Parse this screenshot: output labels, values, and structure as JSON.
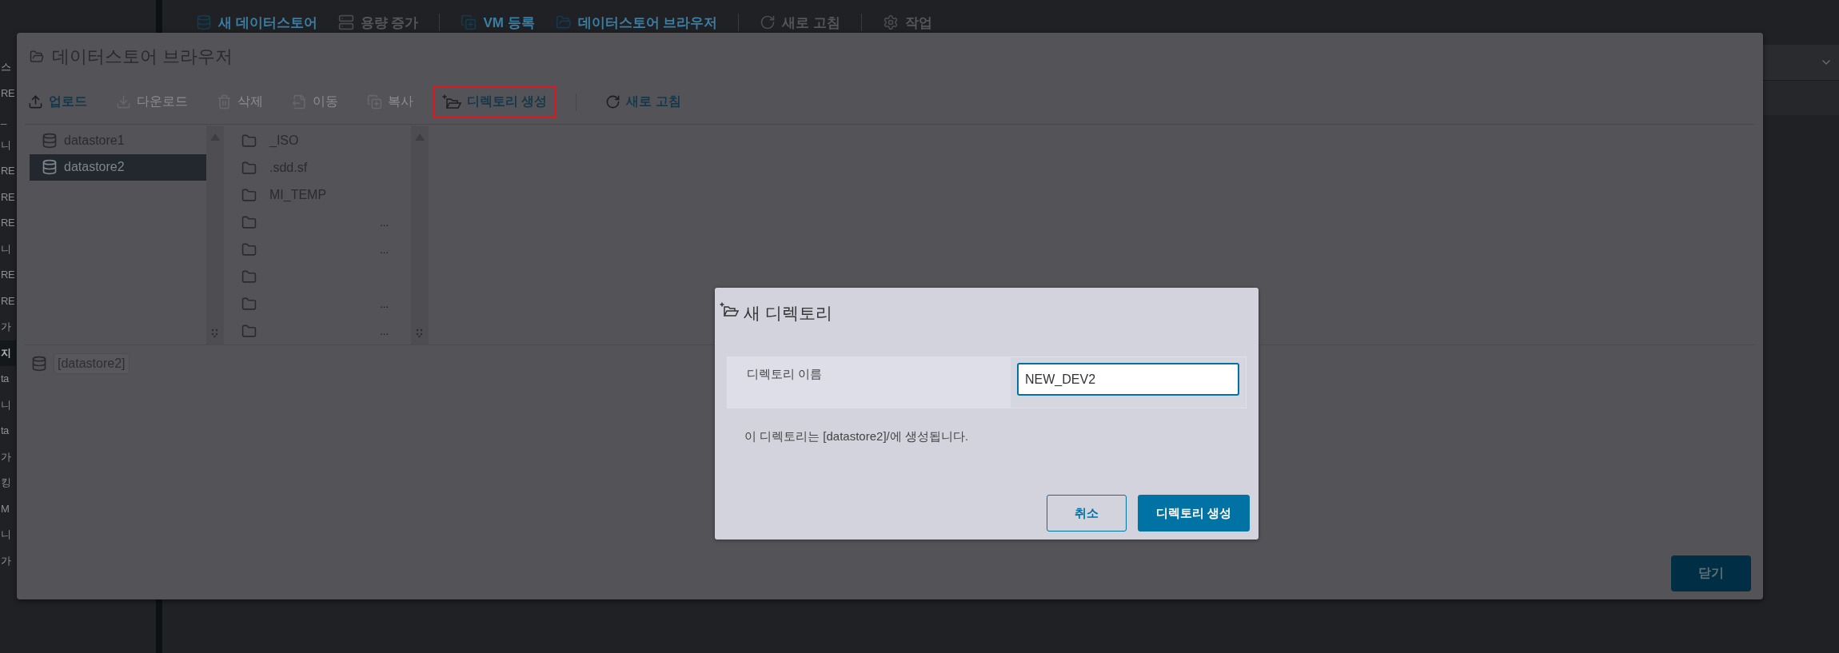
{
  "sidebar": {
    "fragments": [
      {
        "text": "스",
        "selected": false
      },
      {
        "text": "RE",
        "selected": false
      },
      {
        "text": "_",
        "selected": false
      },
      {
        "text": "니",
        "selected": false
      },
      {
        "text": "RE",
        "selected": false
      },
      {
        "text": "RE",
        "selected": false
      },
      {
        "text": "RE",
        "selected": false
      },
      {
        "text": "니",
        "selected": false
      },
      {
        "text": "RE",
        "selected": false
      },
      {
        "text": "RE",
        "selected": false
      },
      {
        "text": "가",
        "selected": false
      },
      {
        "text": "지",
        "selected": true
      },
      {
        "text": "ta",
        "selected": false
      },
      {
        "text": "니",
        "selected": false
      },
      {
        "text": "ta",
        "selected": false
      },
      {
        "text": "가",
        "selected": false
      },
      {
        "text": "킹",
        "selected": false
      },
      {
        "text": "M",
        "selected": false
      },
      {
        "text": "니",
        "selected": false
      },
      {
        "text": "가",
        "selected": false
      }
    ]
  },
  "top_toolbar": [
    {
      "label": "새 데이터스토어",
      "disabled": false,
      "divider_before": false
    },
    {
      "label": "용량 증가",
      "disabled": true,
      "divider_before": false
    },
    {
      "label": "VM 등록",
      "disabled": false,
      "divider_before": true
    },
    {
      "label": "데이터스토어 브라우저",
      "disabled": false,
      "divider_before": false
    },
    {
      "label": "새로 고침",
      "disabled": true,
      "divider_before": true
    },
    {
      "label": "작업",
      "disabled": true,
      "divider_before": true
    }
  ],
  "browser_dialog": {
    "title": "데이터스토어 브라우저",
    "toolbar": [
      {
        "label": "업로드",
        "disabled": false,
        "highlighted": false,
        "divider_before": false
      },
      {
        "label": "다운로드",
        "disabled": true,
        "highlighted": false,
        "divider_before": false
      },
      {
        "label": "삭제",
        "disabled": true,
        "highlighted": false,
        "divider_before": false
      },
      {
        "label": "이동",
        "disabled": true,
        "highlighted": false,
        "divider_before": false
      },
      {
        "label": "복사",
        "disabled": true,
        "highlighted": false,
        "divider_before": false
      },
      {
        "label": "디렉토리 생성",
        "disabled": false,
        "highlighted": true,
        "divider_before": false
      },
      {
        "label": "새로 고침",
        "disabled": false,
        "highlighted": false,
        "divider_before": true
      }
    ],
    "datastores": [
      {
        "name": "datastore1",
        "selected": false
      },
      {
        "name": "datastore2",
        "selected": true
      }
    ],
    "folders": [
      {
        "kind": "named",
        "name": "_ISO"
      },
      {
        "kind": "named",
        "name": ".sdd.sf"
      },
      {
        "kind": "named",
        "name": "MI_TEMP"
      },
      {
        "kind": "truncated",
        "trailing": "..."
      },
      {
        "kind": "truncated",
        "trailing": "..."
      },
      {
        "kind": "blank"
      },
      {
        "kind": "truncated",
        "trailing": "..."
      },
      {
        "kind": "truncated",
        "trailing": "..."
      }
    ],
    "path": "[datastore2]",
    "close_button": "닫기"
  },
  "new_directory_dialog": {
    "title": "새 디렉토리",
    "field_label": "디렉토리 이름",
    "field_value": "NEW_DEV2",
    "help_text": "이 디렉토리는 [datastore2]/에 생성됩니다.",
    "buttons": [
      {
        "label": "취소",
        "kind": "secondary"
      },
      {
        "label": "디렉토리 생성",
        "kind": "primary"
      }
    ]
  }
}
